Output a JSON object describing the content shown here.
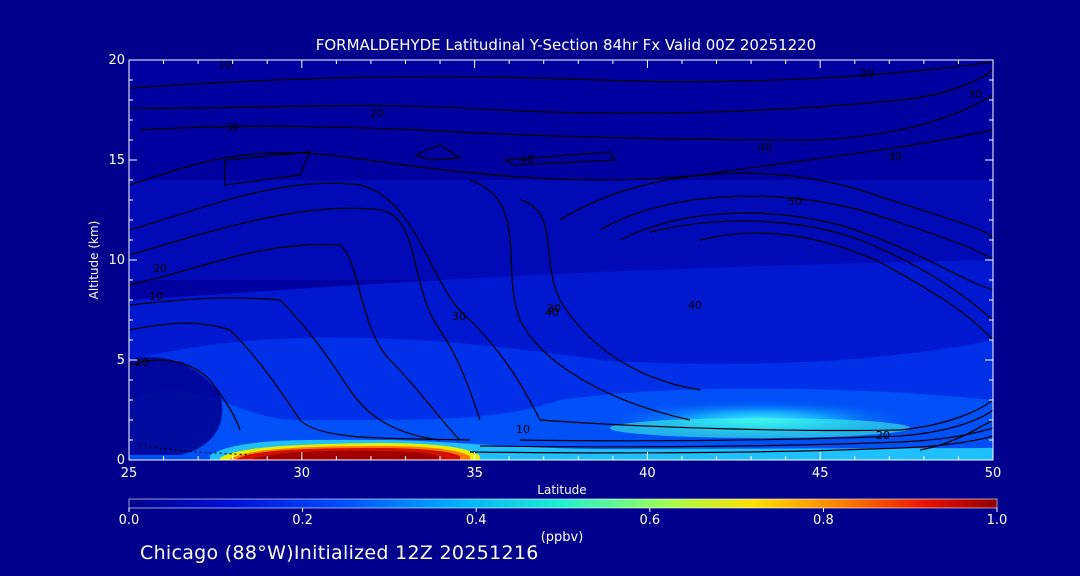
{
  "chart_data": {
    "type": "heatmap",
    "title": "FORMALDEHYDE Latitudinal Y-Section 84hr  Fx Valid 00Z 20251220",
    "xlabel": "Latitude",
    "ylabel": "Altitude (km)",
    "xlim": [
      25,
      50
    ],
    "ylim": [
      0,
      20
    ],
    "x_ticks": [
      "25",
      "30",
      "35",
      "40",
      "45",
      "50"
    ],
    "y_ticks": [
      "0",
      "5",
      "10",
      "15",
      "20"
    ],
    "colorbar": {
      "label": "(ppbv)",
      "range": [
        0.0,
        1.0
      ],
      "ticks": [
        "0.0",
        "0.2",
        "0.4",
        "0.6",
        "0.8",
        "1.0"
      ]
    },
    "contour_labels": [
      "10",
      "20",
      "30",
      "40",
      "50",
      "20",
      "30",
      "40",
      "30",
      "40",
      "40",
      "30",
      "20",
      "10",
      "30",
      "20",
      "10",
      "20"
    ],
    "footer": "Chicago (88°W)Initialized 12Z 20251216"
  }
}
